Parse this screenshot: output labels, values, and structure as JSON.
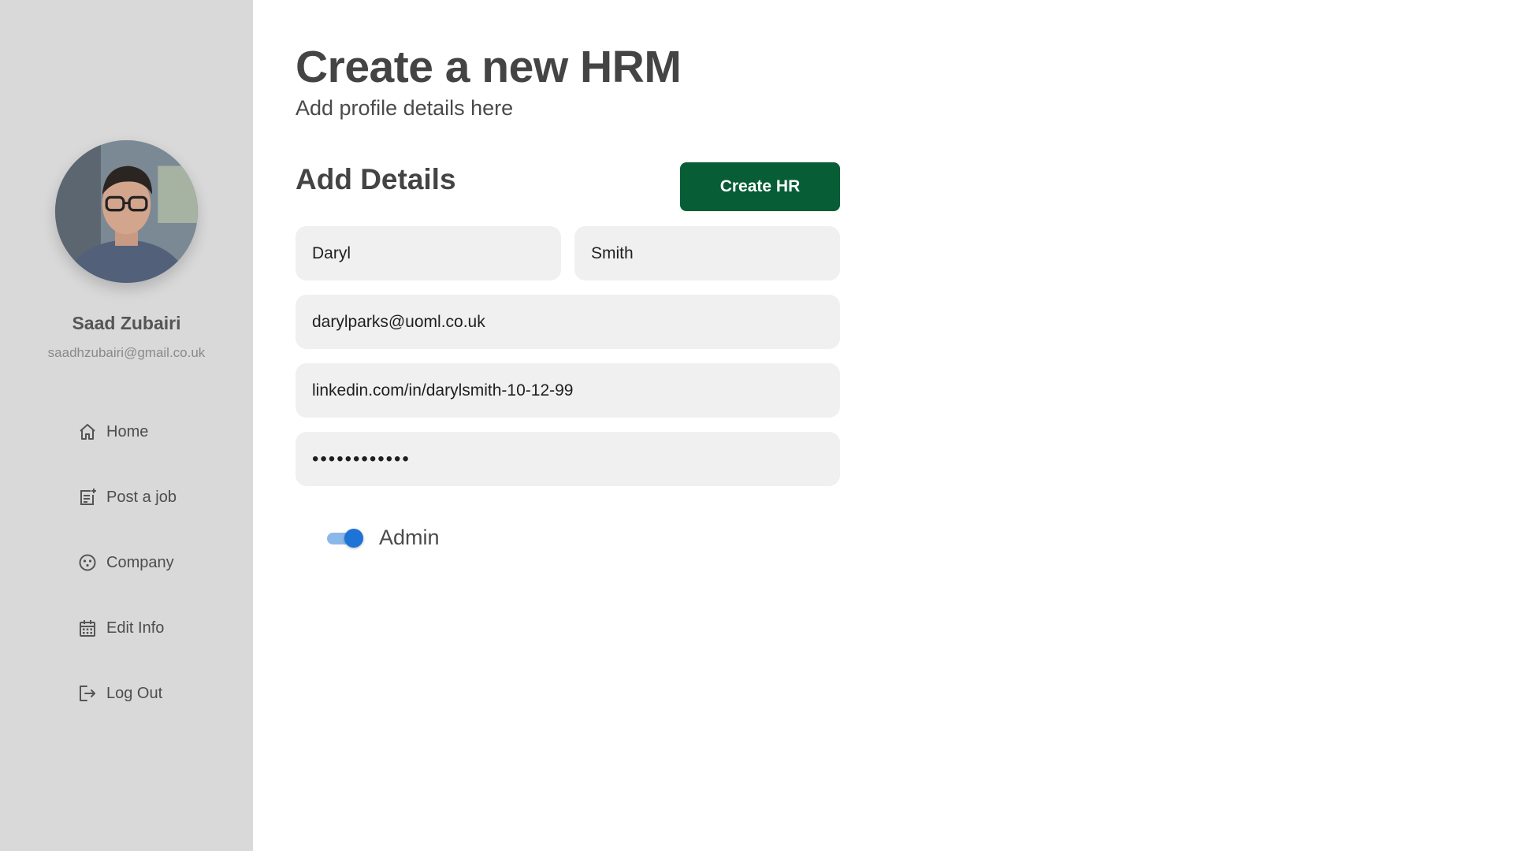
{
  "sidebar": {
    "user": {
      "name": "Saad Zubairi",
      "email": "saadhzubairi@gmail.co.uk",
      "avatar_icon": "user-photo"
    },
    "nav": [
      {
        "label": "Home",
        "icon": "home-icon"
      },
      {
        "label": "Post a job",
        "icon": "post-job-icon"
      },
      {
        "label": "Company",
        "icon": "company-icon"
      },
      {
        "label": "Edit Info",
        "icon": "calendar-icon"
      },
      {
        "label": "Log Out",
        "icon": "logout-icon"
      }
    ]
  },
  "main": {
    "title": "Create a new HRM",
    "subtitle": "Add profile details here",
    "section_title": "Add Details",
    "create_button": "Create HR",
    "form": {
      "first_name": "Daryl",
      "last_name": "Smith",
      "email": "darylparks@uoml.co.uk",
      "linkedin": "linkedin.com/in/darylsmith-10-12-99",
      "password": "••••••••••••"
    },
    "admin_toggle": {
      "label": "Admin",
      "checked": true
    }
  },
  "colors": {
    "sidebar_bg": "#d9d9d9",
    "primary_button": "#075d35",
    "toggle_accent": "#1e73d6",
    "field_bg": "#f0f0f0"
  }
}
